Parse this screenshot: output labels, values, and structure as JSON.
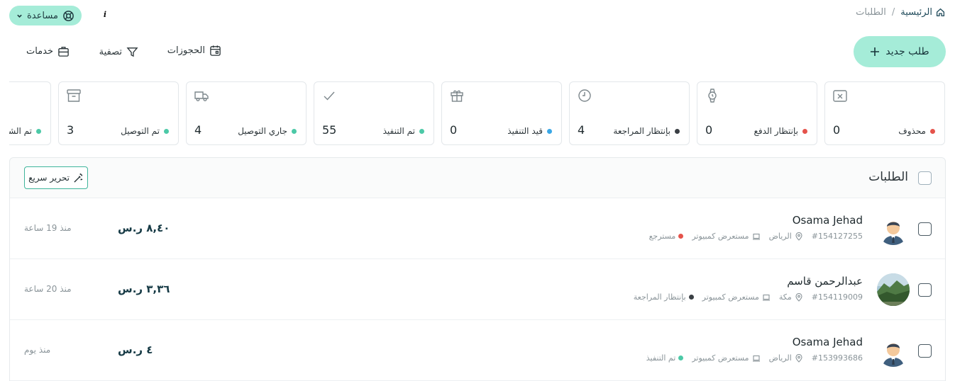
{
  "breadcrumb": {
    "home": "الرئيسية",
    "separator": "/",
    "current": "الطلبات"
  },
  "help": {
    "label": "مساعدة"
  },
  "toolbar": {
    "new_order": "طلب جديد",
    "bookings": "الحجوزات",
    "filter": "تصفية",
    "services": "خدمات"
  },
  "status_cards": [
    {
      "label": "محذوف",
      "count": "0",
      "dot_color": "#e5534b",
      "icon": "trash-box-icon"
    },
    {
      "label": "بإنتظار الدفع",
      "count": "0",
      "dot_color": "#e5534b",
      "icon": "watch-icon"
    },
    {
      "label": "بإنتظار المراجعة",
      "count": "4",
      "dot_color": "#3a3f44",
      "icon": "clock-icon"
    },
    {
      "label": "قيد التنفيذ",
      "count": "0",
      "dot_color": "#3aa7e6",
      "icon": "gift-icon"
    },
    {
      "label": "تم التنفيذ",
      "count": "55",
      "dot_color": "#4cc9a7",
      "icon": "check-icon"
    },
    {
      "label": "جاري التوصيل",
      "count": "4",
      "dot_color": "#4cc9a7",
      "icon": "truck-icon"
    },
    {
      "label": "تم التوصيل",
      "count": "3",
      "dot_color": "#4cc9a7",
      "icon": "archive-icon"
    },
    {
      "label": "تم الشـ",
      "count": "",
      "dot_color": "#4cc9a7",
      "icon": "archive-icon"
    }
  ],
  "orders_panel": {
    "title": "الطلبات",
    "quick_edit": "تحرير سريع"
  },
  "orders": [
    {
      "name": "Osama Jehad",
      "order_id": "#154127255",
      "city": "الرياض",
      "source": "مستعرض كمبيوتر",
      "status": "مسترجع",
      "status_color": "#e5534b",
      "price": "٨,٤٠ ر.س",
      "time": "منذ 19 ساعة",
      "avatar": "person-avatar"
    },
    {
      "name": "عبدالرحمن قاسم",
      "order_id": "#154119009",
      "city": "مكة",
      "source": "مستعرض كمبيوتر",
      "status": "بإنتظار المراجعة",
      "status_color": "#3a3f44",
      "price": "٣,٣٦ ر.س",
      "time": "منذ 20 ساعة",
      "avatar": "landscape-avatar"
    },
    {
      "name": "Osama Jehad",
      "order_id": "#153993686",
      "city": "الرياض",
      "source": "مستعرض كمبيوتر",
      "status": "تم التنفيذ",
      "status_color": "#4cc9a7",
      "price": "٤ ر.س",
      "time": "منذ يوم",
      "avatar": "person-avatar"
    }
  ]
}
